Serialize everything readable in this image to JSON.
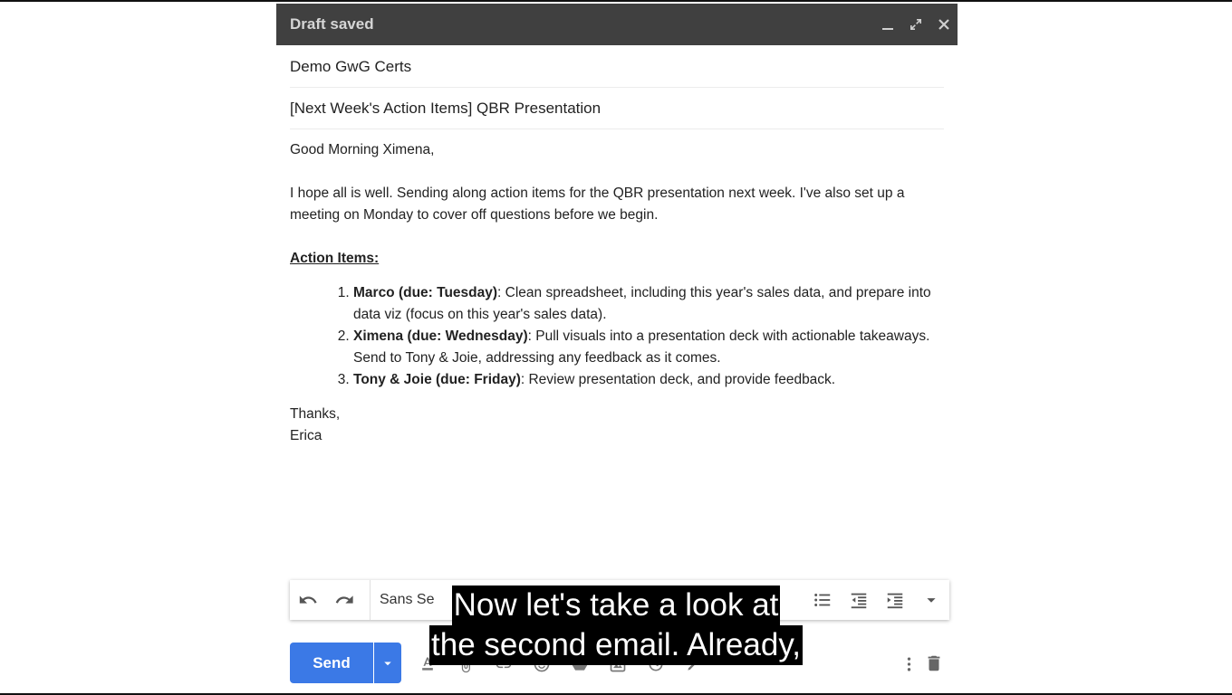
{
  "window": {
    "title": "Draft saved",
    "controls": [
      "minimize-icon",
      "expand-icon",
      "close-icon"
    ]
  },
  "fields": {
    "to": "Demo GwG Certs",
    "subject": "[Next Week's Action Items] QBR Presentation"
  },
  "body": {
    "greeting": "Good Morning Ximena,",
    "intro": "I hope all is well. Sending along action items for the QBR presentation next week. I've also set up a meeting on Monday to cover off questions before we begin.",
    "action_heading": "Action Items:",
    "items": [
      {
        "name": "Marco (due: Tuesday)",
        "text": ": Clean spreadsheet, including this year's sales data, and prepare into data viz (focus on this year's sales data)."
      },
      {
        "name": "Ximena (due: Wednesday)",
        "text": ": Pull visuals into a presentation deck with actionable takeaways. Send to Tony & Joie, addressing any feedback as it comes."
      },
      {
        "name": "Tony & Joie (due: Friday)",
        "text": ": Review presentation deck, and provide feedback."
      }
    ],
    "signoff": "Thanks,",
    "signature": "Erica"
  },
  "toolbar": {
    "font": "Sans Se",
    "icons": [
      "undo-icon",
      "redo-icon",
      "bulleted-list-icon",
      "indent-less-icon",
      "indent-more-icon",
      "more-formatting-icon"
    ]
  },
  "send": {
    "label": "Send"
  },
  "captions": {
    "line1": "Now let's take a look at",
    "line2": "the second email. Already,"
  }
}
